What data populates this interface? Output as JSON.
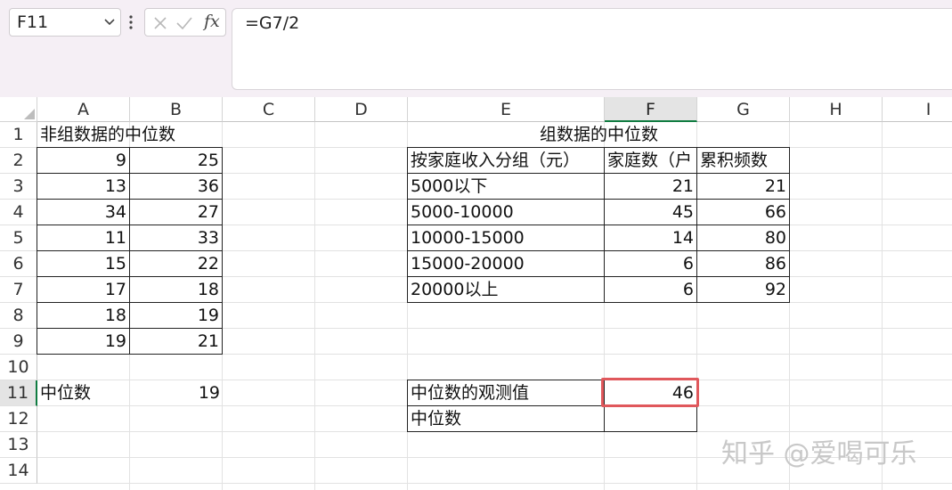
{
  "formula_bar": {
    "name_box": "F11",
    "fx_label": "fx",
    "formula": "=G7/2"
  },
  "columns": [
    "A",
    "B",
    "C",
    "D",
    "E",
    "F",
    "G",
    "H",
    "I"
  ],
  "rows": [
    "1",
    "2",
    "3",
    "4",
    "5",
    "6",
    "7",
    "8",
    "9",
    "10",
    "11",
    "12",
    "13",
    "14"
  ],
  "selected": {
    "column": "F",
    "row": "11"
  },
  "left_table": {
    "title": "非组数据的中位数",
    "rows": [
      [
        "9",
        "25"
      ],
      [
        "13",
        "36"
      ],
      [
        "34",
        "27"
      ],
      [
        "11",
        "33"
      ],
      [
        "15",
        "22"
      ],
      [
        "17",
        "18"
      ],
      [
        "18",
        "19"
      ],
      [
        "19",
        "21"
      ]
    ],
    "median_label": "中位数",
    "median_value": "19"
  },
  "right_table": {
    "title": "组数据的中位数",
    "headers": [
      "按家庭收入分组（元）",
      "家庭数（户",
      "累积频数"
    ],
    "rows": [
      [
        "5000以下",
        "21",
        "21"
      ],
      [
        "5000-10000",
        "45",
        "66"
      ],
      [
        "10000-15000",
        "14",
        "80"
      ],
      [
        "15000-20000",
        "6",
        "86"
      ],
      [
        "20000以上",
        "6",
        "92"
      ]
    ],
    "observed_label": "中位数的观测值",
    "observed_value": "46",
    "median_label": "中位数",
    "median_value": ""
  },
  "watermark": "知乎 @爱喝可乐",
  "colors": {
    "ribbon_bg": "#f5eff5",
    "selection_accent": "#107c41",
    "active_cell_border": "#e0585c",
    "header_selected_bg": "#e4e4e4"
  },
  "icons": [
    "chevron-down-icon",
    "more-options-icon",
    "cancel-icon",
    "enter-check-icon",
    "select-all-icon"
  ]
}
